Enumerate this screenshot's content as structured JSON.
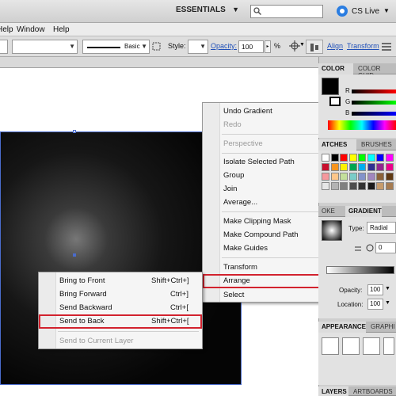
{
  "appbar": {
    "workspace": "ESSENTIALS",
    "cslive": "CS Live"
  },
  "menubar": {
    "items": [
      "Help",
      "Window",
      "Help"
    ]
  },
  "controlbar": {
    "brush_label": "Basic",
    "style_label": "Style:",
    "opacity_label": "Opacity:",
    "opacity_value": "100",
    "opacity_unit": "%",
    "align_link": "Align",
    "transform_link": "Transform"
  },
  "context_menu": {
    "items": [
      {
        "label": "Undo Gradient",
        "enabled": true
      },
      {
        "label": "Redo",
        "enabled": false
      },
      {
        "label": "Perspective",
        "enabled": false,
        "submenu": true
      },
      {
        "label": "Isolate Selected Path",
        "enabled": true
      },
      {
        "label": "Group",
        "enabled": true
      },
      {
        "label": "Join",
        "enabled": true
      },
      {
        "label": "Average...",
        "enabled": true
      },
      {
        "label": "Make Clipping Mask",
        "enabled": true
      },
      {
        "label": "Make Compound Path",
        "enabled": true
      },
      {
        "label": "Make Guides",
        "enabled": true
      },
      {
        "label": "Transform",
        "enabled": true,
        "submenu": true
      },
      {
        "label": "Arrange",
        "enabled": true,
        "submenu": true,
        "highlighted": true
      },
      {
        "label": "Select",
        "enabled": true,
        "submenu": true
      }
    ]
  },
  "arrange_submenu": {
    "items": [
      {
        "label": "Bring to Front",
        "shortcut": "Shift+Ctrl+]"
      },
      {
        "label": "Bring Forward",
        "shortcut": "Ctrl+]"
      },
      {
        "label": "Send Backward",
        "shortcut": "Ctrl+["
      },
      {
        "label": "Send to Back",
        "shortcut": "Shift+Ctrl+[",
        "highlighted": true
      },
      {
        "label": "Send to Current Layer",
        "shortcut": "",
        "enabled": false
      }
    ]
  },
  "panels": {
    "color_tab": "COLOR",
    "color_guide_tab": "COLOR GUID",
    "color_channels": [
      "R",
      "G",
      "B"
    ],
    "swatches_tab": "ATCHES",
    "brushes_tab": "BRUSHES",
    "stroke_tab": "OKE",
    "gradient_tab": "GRADIENT",
    "gradient_type_label": "Type:",
    "gradient_type_value": "Radial",
    "gradient_angle": "0",
    "opacity_label": "Opacity:",
    "opacity_value": "100",
    "location_label": "Location:",
    "location_value": "100",
    "appearance_tab": "APPEARANCE",
    "graphic_tab": "GRAPHI",
    "layers_tab": "LAYERS",
    "artboards_tab": "ARTBOARDS"
  },
  "colors": {
    "highlight": "#d2222e",
    "selection": "#4a6ccc",
    "link": "#2050b8"
  }
}
